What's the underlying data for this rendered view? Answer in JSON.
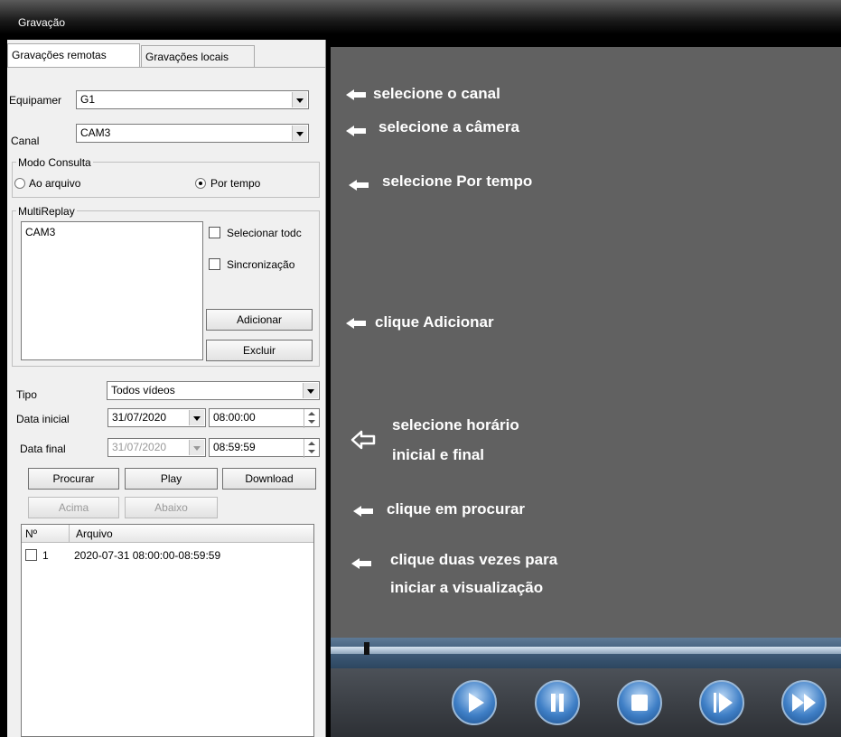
{
  "window": {
    "title": "Gravação"
  },
  "tabs": [
    {
      "label": "Gravações remotas"
    },
    {
      "label": "Gravações locais"
    }
  ],
  "form": {
    "device_label": "Equipamer",
    "device_value": "G1",
    "channel_label": "Canal",
    "channel_value": "CAM3",
    "query_mode": {
      "title": "Modo Consulta",
      "option_file": "Ao arquivo",
      "option_time": "Por tempo",
      "selected": "Por tempo"
    },
    "multireplay": {
      "title": "MultiReplay",
      "items": [
        "CAM3"
      ],
      "select_all_label": "Selecionar todc",
      "sync_label": "Sincronização",
      "add_label": "Adicionar",
      "delete_label": "Excluir"
    },
    "type_label": "Tipo",
    "type_value": "Todos vídeos",
    "start_label": "Data inicial",
    "start_date": "31/07/2020",
    "start_time": "08:00:00",
    "end_label": "Data final",
    "end_date": "31/07/2020",
    "end_time": "08:59:59",
    "search_label": "Procurar",
    "play_label": "Play",
    "download_label": "Download",
    "up_label": "Acima",
    "down_label": "Abaixo"
  },
  "file_table": {
    "columns": [
      "Nº",
      "Arquivo"
    ],
    "rows": [
      {
        "num": "1",
        "file": "2020-07-31 08:00:00-08:59:59"
      }
    ]
  },
  "annotations": [
    "selecione o canal",
    "selecione a câmera",
    "selecione Por tempo",
    "clique Adicionar",
    "selecione horário",
    "inicial e final",
    "clique em procurar",
    "clique duas vezes para",
    "iniciar a visualização"
  ],
  "playback": {
    "progress": 0.07
  },
  "colors": {
    "video_bg": "#616161",
    "annotation_text": "#ffffff",
    "button_blue": "#3f7fc6"
  }
}
